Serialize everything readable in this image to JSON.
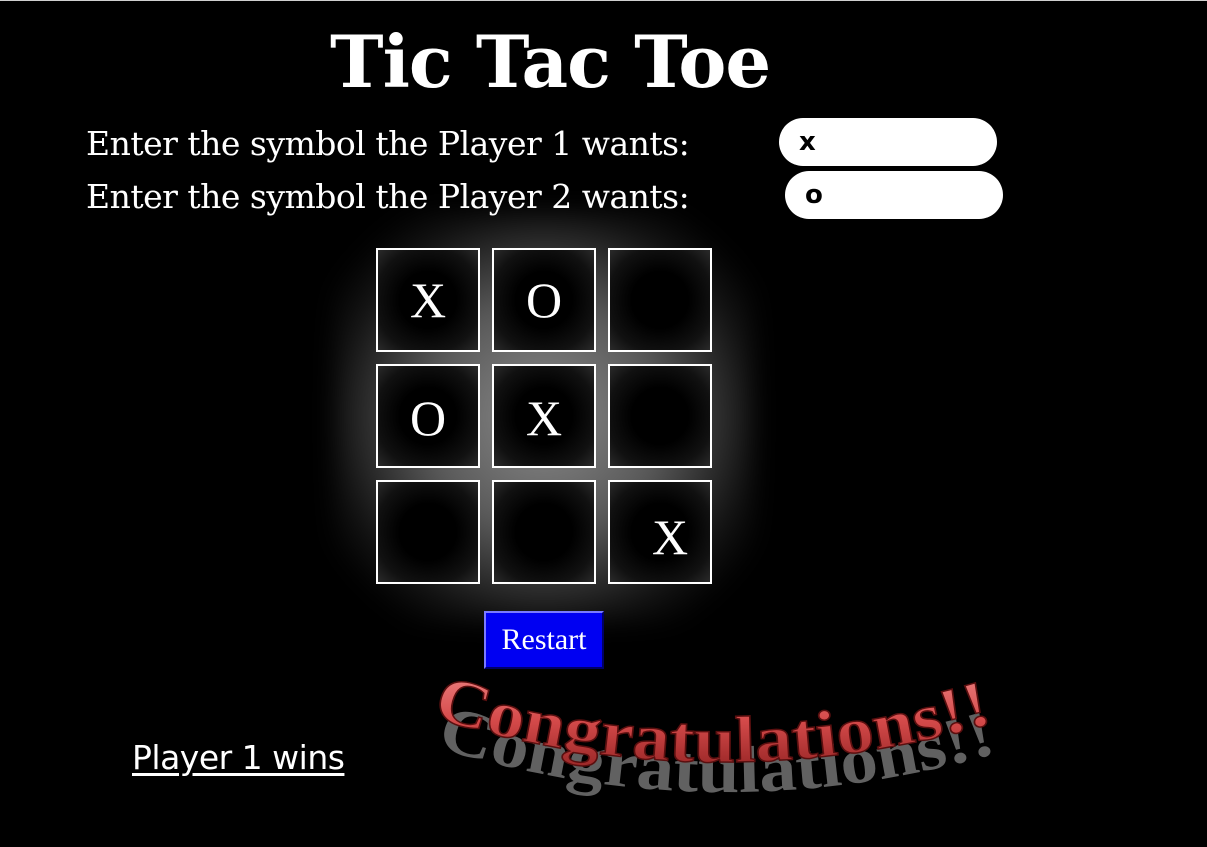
{
  "title": "Tic Tac Toe",
  "prompts": {
    "player1": "Enter the symbol the Player 1 wants:",
    "player2": "Enter the symbol the Player 2 wants:"
  },
  "inputs": {
    "player1_value": "x",
    "player2_value": "o"
  },
  "board": [
    "X",
    "O",
    "",
    "O",
    "X",
    "",
    "",
    "",
    "X"
  ],
  "restart_label": "Restart",
  "status": "Player 1 wins",
  "banner": {
    "text": "Congratulations!!",
    "color": "#d64b4b",
    "shadow_color": "#9a9a9a"
  },
  "colors": {
    "background": "#000000",
    "restart_button": "#0000f2"
  }
}
